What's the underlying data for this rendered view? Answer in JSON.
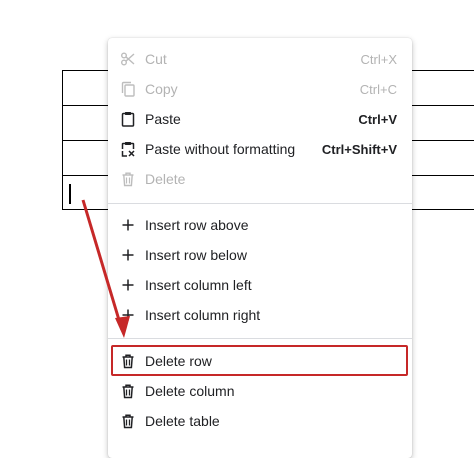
{
  "menu": {
    "clipboard": [
      {
        "label": "Cut",
        "shortcut": "Ctrl+X",
        "icon": "scissors-icon",
        "enabled": false
      },
      {
        "label": "Copy",
        "shortcut": "Ctrl+C",
        "icon": "copy-icon",
        "enabled": false
      },
      {
        "label": "Paste",
        "shortcut": "Ctrl+V",
        "icon": "clipboard-icon",
        "enabled": true
      },
      {
        "label": "Paste without formatting",
        "shortcut": "Ctrl+Shift+V",
        "icon": "clipboard-format-icon",
        "enabled": true
      },
      {
        "label": "Delete",
        "shortcut": "",
        "icon": "trash-icon",
        "enabled": false
      }
    ],
    "insert": [
      {
        "label": "Insert row above",
        "icon": "plus-icon"
      },
      {
        "label": "Insert row below",
        "icon": "plus-icon"
      },
      {
        "label": "Insert column left",
        "icon": "plus-icon"
      },
      {
        "label": "Insert column right",
        "icon": "plus-icon"
      }
    ],
    "delete": [
      {
        "label": "Delete row",
        "icon": "trash-icon",
        "highlighted": true
      },
      {
        "label": "Delete column",
        "icon": "trash-icon"
      },
      {
        "label": "Delete table",
        "icon": "trash-icon"
      }
    ]
  },
  "colors": {
    "annotation": "#c62828",
    "disabled_text": "#b3b3b3",
    "text": "#202124"
  }
}
